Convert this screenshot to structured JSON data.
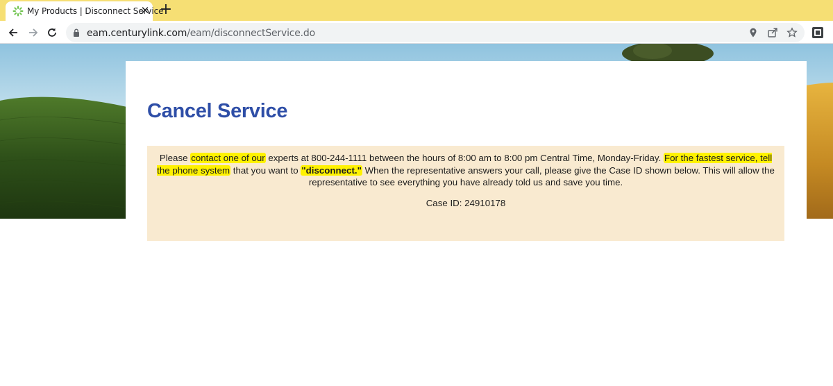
{
  "browser": {
    "tab_title": "My Products | Disconnect Service",
    "tab_favicon": "centurylink-logo-icon",
    "url_host": "eam.centurylink.com",
    "url_path": "/eam/disconnectService.do",
    "colors": {
      "tabstrip": "#f6df74",
      "omnibox": "#f1f3f4"
    }
  },
  "page": {
    "heading": "Cancel Service",
    "notice": {
      "segment_1": "Please ",
      "segment_2_highlighted": "contact one of our",
      "segment_3": " experts at 800-244-1111 between the hours of 8:00 am to 8:00 pm Central Time, Monday-Friday. ",
      "segment_4_highlighted": "For the fastest service, tell the phone system",
      "segment_5": " that you want to ",
      "segment_6_bold_highlighted": "\"disconnect.\"",
      "segment_7": " When the representative answers your call, please give the Case ID shown below. This will allow the representative to see everything you have already told us and save you time."
    },
    "case_id": "Case ID: 24910178",
    "colors": {
      "heading": "#2e4ea7",
      "notice_bg": "#f9ead0",
      "highlight": "#fff200"
    }
  }
}
